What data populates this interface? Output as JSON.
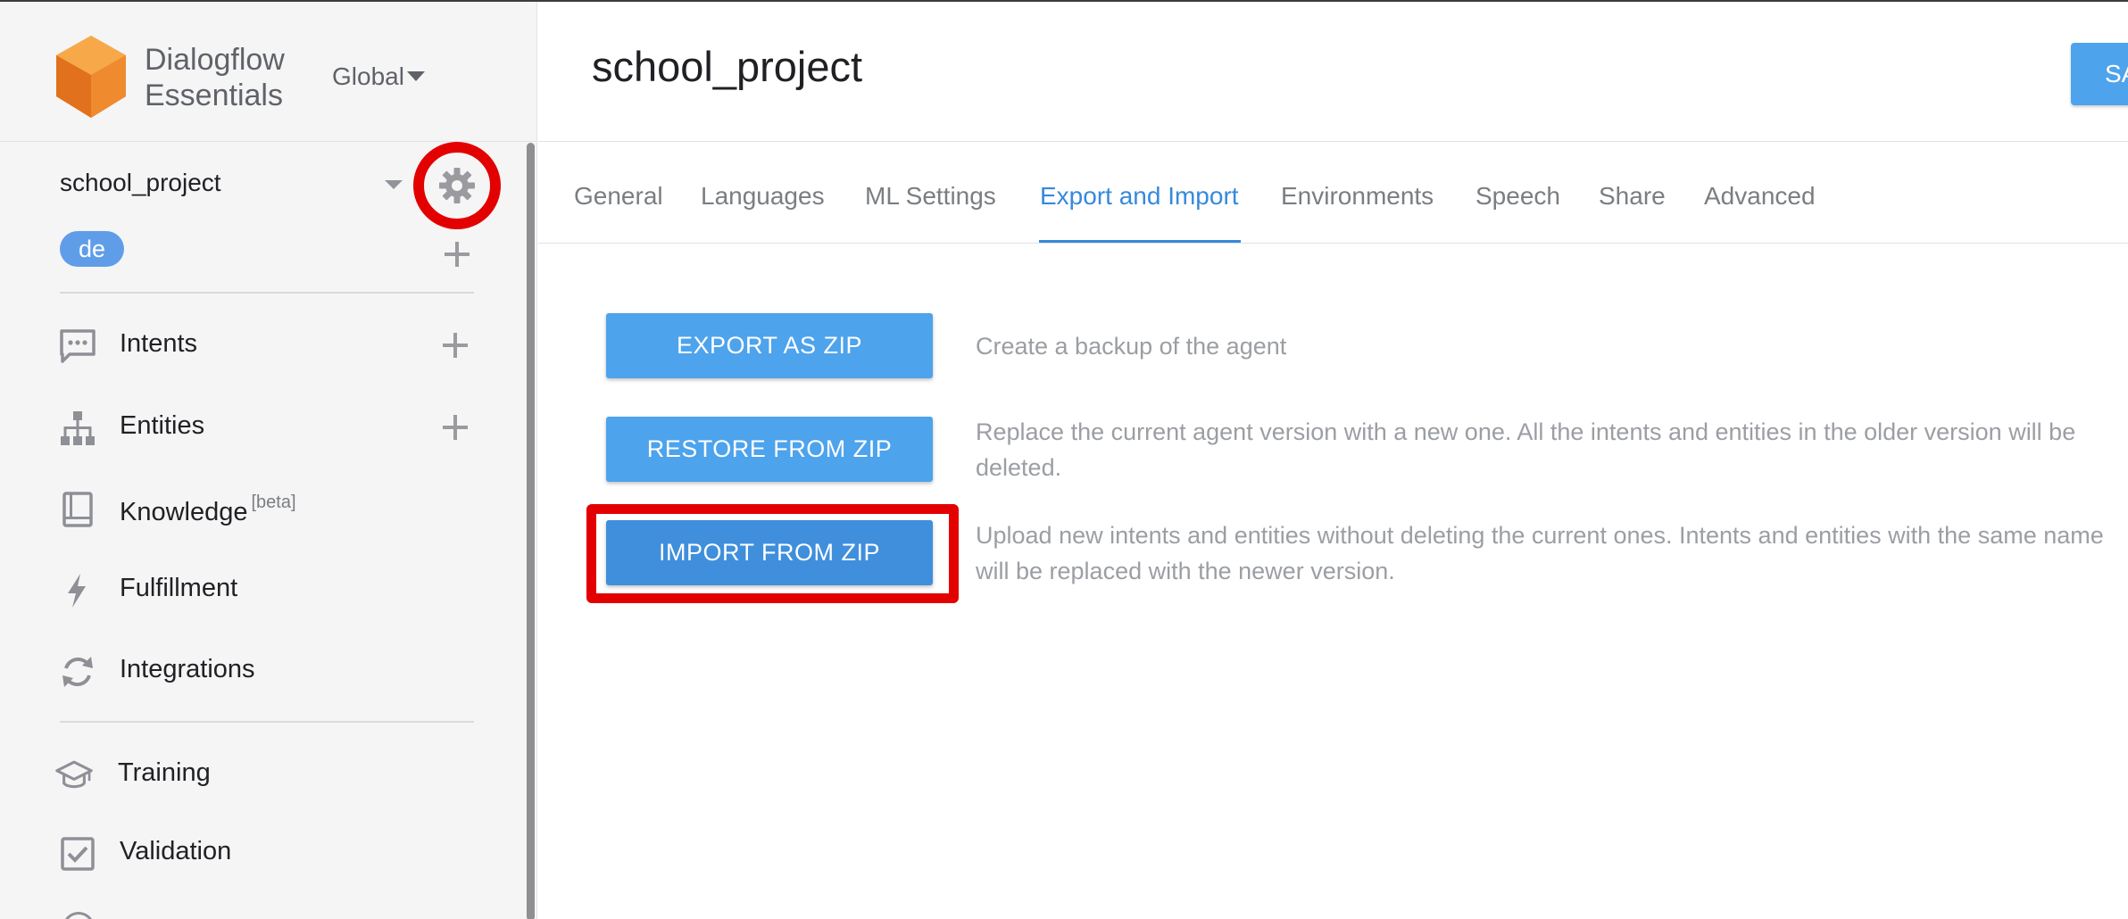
{
  "app": {
    "brand_line1": "Dialogflow",
    "brand_line2": "Essentials",
    "region": "Global"
  },
  "sidebar": {
    "agent_name": "school_project",
    "language": "de",
    "items": [
      {
        "label": "Intents",
        "icon": "chat-bubble-icon"
      },
      {
        "label": "Entities",
        "icon": "hierarchy-icon"
      },
      {
        "label": "Knowledge",
        "badge": "[beta]",
        "icon": "book-icon"
      },
      {
        "label": "Fulfillment",
        "icon": "lightning-icon"
      },
      {
        "label": "Integrations",
        "icon": "sync-icon"
      },
      {
        "label": "Training",
        "icon": "graduation-cap-icon"
      },
      {
        "label": "Validation",
        "icon": "checkbox-icon"
      }
    ]
  },
  "header": {
    "title": "school_project",
    "save_label": "SAVE"
  },
  "tabs": [
    {
      "label": "General"
    },
    {
      "label": "Languages"
    },
    {
      "label": "ML Settings"
    },
    {
      "label": "Export and Import",
      "active": true
    },
    {
      "label": "Environments"
    },
    {
      "label": "Speech"
    },
    {
      "label": "Share"
    },
    {
      "label": "Advanced"
    }
  ],
  "actions": [
    {
      "label": "EXPORT AS ZIP",
      "description": "Create a backup of the agent"
    },
    {
      "label": "RESTORE FROM ZIP",
      "description": "Replace the current agent version with a new one. All the intents and entities in the older version will be deleted."
    },
    {
      "label": "IMPORT FROM ZIP",
      "description": "Upload new intents and entities without deleting the current ones. Intents and entities with the same name will be replaced with the newer version."
    }
  ],
  "colors": {
    "accent": "#4da3ec",
    "active_tab": "#3689dc",
    "highlight": "#e30000",
    "sidebar_bg": "#f5f5f6",
    "logo_orange": "#f4983a"
  }
}
